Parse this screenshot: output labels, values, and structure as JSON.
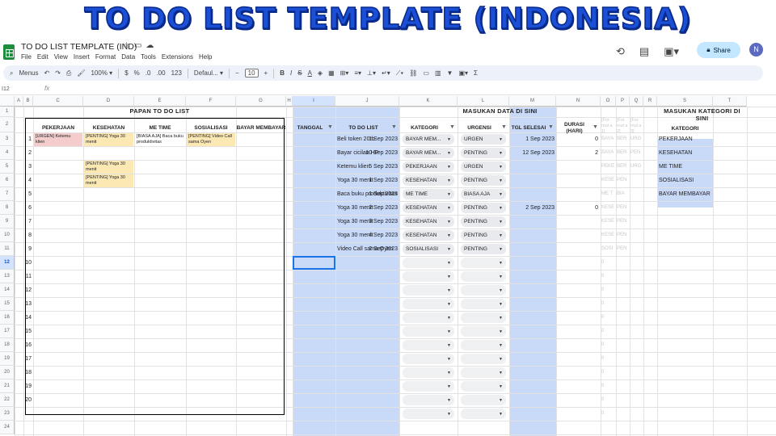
{
  "banner": {
    "title": "TO DO LIST TEMPLATE (INDONESIA)"
  },
  "app": {
    "doc_title": "TO DO LIST TEMPLATE (IND)",
    "share_label": "Share",
    "avatar_letter": "N"
  },
  "menu": [
    "File",
    "Edit",
    "View",
    "Insert",
    "Format",
    "Data",
    "Tools",
    "Extensions",
    "Help"
  ],
  "toolbar": {
    "menus_label": "Menus",
    "zoom": "100%",
    "currency": "$",
    "percent": "%",
    "dec_less": ".0",
    "dec_more": ".00",
    "num_format": "123",
    "font": "Defaul...",
    "font_size": "10"
  },
  "formula": {
    "cell_ref": "I12",
    "fx": "fx"
  },
  "columns": [
    "A",
    "B",
    "C",
    "D",
    "E",
    "F",
    "G",
    "H",
    "I",
    "J",
    "K",
    "L",
    "M",
    "N",
    "O",
    "P",
    "Q",
    "R",
    "S",
    "T"
  ],
  "rows": [
    "1",
    "2",
    "3",
    "4",
    "5",
    "6",
    "7",
    "8",
    "9",
    "10",
    "11",
    "12",
    "13",
    "14",
    "15",
    "16",
    "17",
    "18",
    "19",
    "20",
    "21",
    "22",
    "23",
    "24"
  ],
  "board": {
    "title": "PAPAN TO DO LIST",
    "headers": [
      "PEKERJAAN",
      "KESEHATAN",
      "ME TIME",
      "SOSIALISASI",
      "BAYAR MEMBAYAR"
    ],
    "numbers": [
      "1",
      "2",
      "3",
      "4",
      "5",
      "6",
      "7",
      "8",
      "9",
      "10",
      "11",
      "12",
      "13",
      "14",
      "15",
      "16",
      "17",
      "18",
      "19",
      "20"
    ],
    "notes": [
      {
        "text": "[URGEN] Ketemu klien",
        "bg": "#f4cccc"
      },
      {
        "text": "[PENTING] Yoga 30 menit",
        "bg": "#fce8b2"
      },
      {
        "text": "[BIASA AJA] Baca buku produktivitas",
        "bg": "#ffffff"
      },
      {
        "text": "[PENTING] Video Call sama Oyen",
        "bg": "#fce8b2"
      },
      {
        "text": "[PENTING] Yoga 30 menit",
        "bg": "#fce8b2"
      },
      {
        "text": "[PENTING] Yoga 30 menit",
        "bg": "#fce8b2"
      }
    ]
  },
  "entry": {
    "title": "MASUKAN DATA DI SINI",
    "headers": [
      "TANGGAL",
      "TO DO LIST",
      "KATEGORI",
      "URGENSI",
      "TGL SELESAI",
      "DURASI (HARI)"
    ],
    "rows": [
      {
        "tanggal": "1 Sep 2023",
        "todo": "Beli token 20rb",
        "kategori": "BAYAR MEM...",
        "urgensi": "URGEN",
        "selesai": "1 Sep 2023",
        "durasi": "0"
      },
      {
        "tanggal": "10 Sep 2023",
        "todo": "Bayar cicilan HP",
        "kategori": "BAYAR MEM...",
        "urgensi": "PENTING",
        "selesai": "12 Sep 2023",
        "durasi": "2"
      },
      {
        "tanggal": "5 Sep 2023",
        "todo": "Ketemu klien",
        "kategori": "PEKERJAAN",
        "urgensi": "URGEN",
        "selesai": "",
        "durasi": ""
      },
      {
        "tanggal": "1 Sep 2023",
        "todo": "Yoga 30 menit",
        "kategori": "KESEHATAN",
        "urgensi": "PENTING",
        "selesai": "",
        "durasi": ""
      },
      {
        "tanggal": "1 Sep 2023",
        "todo": "Baca buku produktivitas",
        "kategori": "ME TIME",
        "urgensi": "BIASA AJA",
        "selesai": "",
        "durasi": ""
      },
      {
        "tanggal": "2 Sep 2023",
        "todo": "Yoga 30 menit",
        "kategori": "KESEHATAN",
        "urgensi": "PENTING",
        "selesai": "2 Sep 2023",
        "durasi": "0"
      },
      {
        "tanggal": "3 Sep 2023",
        "todo": "Yoga 30 menit",
        "kategori": "KESEHATAN",
        "urgensi": "PENTING",
        "selesai": "",
        "durasi": ""
      },
      {
        "tanggal": "4 Sep 2023",
        "todo": "Yoga 30 menit",
        "kategori": "KESEHATAN",
        "urgensi": "PENTING",
        "selesai": "",
        "durasi": ""
      },
      {
        "tanggal": "2 Sep 2023",
        "todo": "Video Call sama Oyen",
        "kategori": "SOSIALISASI",
        "urgensi": "PENTING",
        "selesai": "",
        "durasi": ""
      }
    ],
    "empty_durasi": "0"
  },
  "helper": {
    "headers": [
      "[For mul a 1]",
      "[For mul a 2]",
      "[For mul a 3]"
    ],
    "rows": [
      [
        "BAYA",
        "BER",
        "URG"
      ],
      [
        "BAYA",
        "BER",
        "PEN"
      ],
      [
        "PEKE",
        "BER",
        "URG"
      ],
      [
        "KESE",
        "PEN",
        ""
      ],
      [
        "ME T",
        "BIA",
        ""
      ],
      [
        "KESE",
        "PEN",
        ""
      ],
      [
        "KESE",
        "PEN",
        ""
      ],
      [
        "KESE",
        "PEN",
        ""
      ],
      [
        "SOSI",
        "PEN",
        ""
      ]
    ],
    "zero": "0"
  },
  "categories": {
    "title": "MASUKAN KATEGORI DI SINI",
    "header": "KATEGORI",
    "items": [
      "PEKERJAAN",
      "KESEHATAN",
      "ME TIME",
      "SOSIALISASI",
      "BAYAR MEMBAYAR"
    ]
  },
  "colors": {
    "accent": "#1a4fd6",
    "selected_col": "#c9daf8",
    "urgent": "#f4cccc",
    "important": "#fce8b2"
  }
}
